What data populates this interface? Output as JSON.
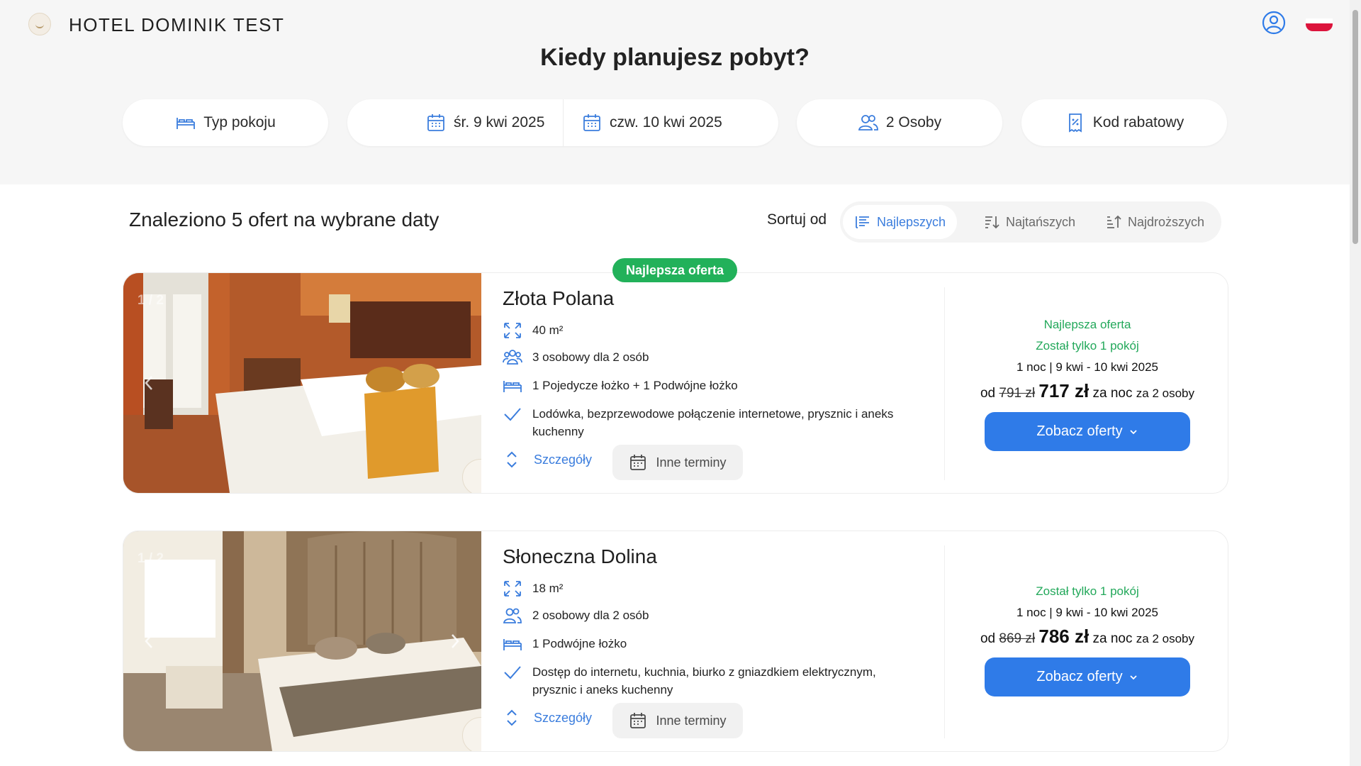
{
  "header": {
    "hotel_name": "HOTEL DOMINIK TEST",
    "headline": "Kiedy planujesz pobyt?"
  },
  "search": {
    "room_type": "Typ pokoju",
    "check_in": "śr. 9 kwi 2025",
    "check_out": "czw. 10 kwi 2025",
    "guests": "2 Osoby",
    "promo": "Kod rabatowy"
  },
  "results": {
    "summary": "Znaleziono 5 ofert na wybrane daty",
    "sort_label": "Sortuj od",
    "sort_options": [
      "Najlepszych",
      "Najtańszych",
      "Najdroższych"
    ],
    "best_badge": "Najlepsza oferta"
  },
  "rooms": [
    {
      "image_counter": "1 / 2",
      "name": "Złota Polana",
      "area": "40 m²",
      "capacity": "3 osobowy dla 2 osób",
      "beds": "1 Pojedycze łożko + 1 Podwójne łożko",
      "amenities": "Lodówka, bezprzewodowe połączenie internetowe, prysznic i aneks kuchenny",
      "details_label": "Szczegóły",
      "other_dates_label": "Inne terminy",
      "best_offer": "Najlepsza oferta",
      "availability": "Został tylko 1 pokój",
      "stay": "1 noc | 9 kwi - 10 kwi 2025",
      "price_from": "od",
      "old_price": "791 zł",
      "price": "717 zł",
      "per_night": "za noc",
      "for_people": "za 2 osoby",
      "cta": "Zobacz oferty"
    },
    {
      "image_counter": "1 / 2",
      "name": "Słoneczna Dolina",
      "area": "18 m²",
      "capacity": "2 osobowy dla 2 osób",
      "beds": "1 Podwójne łożko",
      "amenities": "Dostęp do internetu, kuchnia, biurko z gniazdkiem elektrycznym, prysznic i aneks kuchenny",
      "details_label": "Szczegóły",
      "other_dates_label": "Inne terminy",
      "availability": "Został tylko 1 pokój",
      "stay": "1 noc | 9 kwi - 10 kwi 2025",
      "price_from": "od",
      "old_price": "869 zł",
      "price": "786 zł",
      "per_night": "za noc",
      "for_people": "za 2 osoby",
      "cta": "Zobacz oferty"
    }
  ],
  "colors": {
    "accent": "#2f7be8",
    "green": "#22b15a",
    "flag_red": "#dc143c"
  }
}
